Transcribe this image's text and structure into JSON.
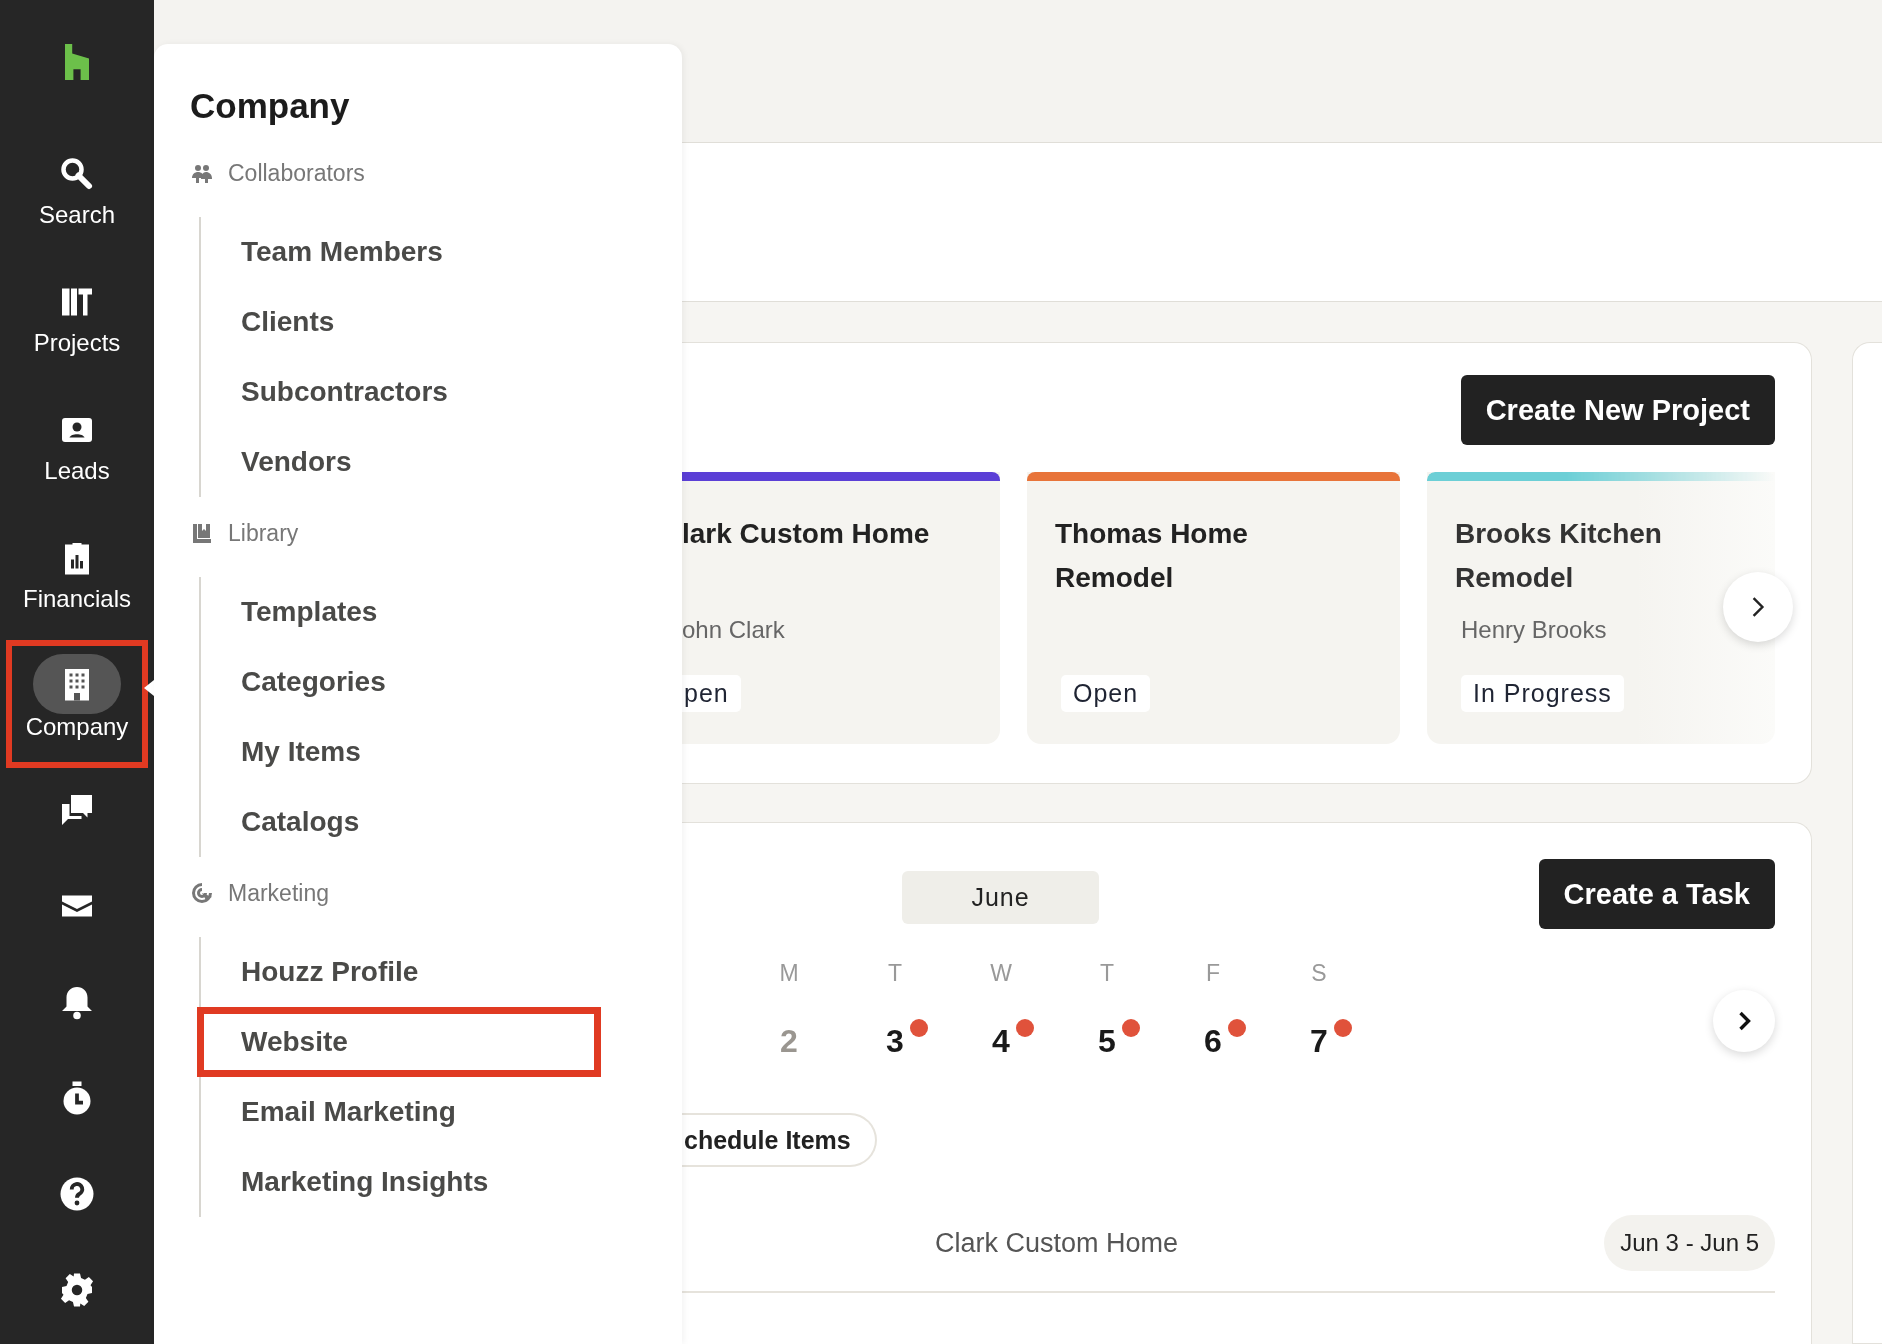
{
  "sidebar": {
    "items": [
      {
        "label": "Search",
        "selected": false,
        "highlighted": false
      },
      {
        "label": "Projects",
        "selected": false,
        "highlighted": false
      },
      {
        "label": "Leads",
        "selected": false,
        "highlighted": false
      },
      {
        "label": "Financials",
        "selected": false,
        "highlighted": false
      },
      {
        "label": "Company",
        "selected": true,
        "highlighted": true
      },
      {
        "selected": false,
        "highlighted": false
      },
      {
        "selected": false,
        "highlighted": false
      },
      {
        "selected": false,
        "highlighted": false
      },
      {
        "selected": false,
        "highlighted": false
      },
      {
        "selected": false,
        "highlighted": false
      },
      {
        "selected": false,
        "highlighted": false
      }
    ]
  },
  "menu": {
    "title": "Company",
    "sections": [
      {
        "heading": "Collaborators",
        "items": [
          {
            "label": "Team Members",
            "highlighted": false
          },
          {
            "label": "Clients",
            "highlighted": false
          },
          {
            "label": "Subcontractors",
            "highlighted": false
          },
          {
            "label": "Vendors",
            "highlighted": false
          }
        ]
      },
      {
        "heading": "Library",
        "items": [
          {
            "label": "Templates",
            "highlighted": false
          },
          {
            "label": "Categories",
            "highlighted": false
          },
          {
            "label": "My Items",
            "highlighted": false
          },
          {
            "label": "Catalogs",
            "highlighted": false
          }
        ]
      },
      {
        "heading": "Marketing",
        "items": [
          {
            "label": "Houzz Profile",
            "highlighted": false
          },
          {
            "label": "Website",
            "highlighted": true
          },
          {
            "label": "Email Marketing",
            "highlighted": false
          },
          {
            "label": "Marketing Insights",
            "highlighted": false
          }
        ]
      }
    ]
  },
  "projects": {
    "button": "Create New Project",
    "cards": [
      {
        "title": "lark Custom Home",
        "client": "ohn Clark",
        "status": "pen",
        "color": "#5b3fd6"
      },
      {
        "title": "Thomas Home Remodel",
        "status": "Open",
        "color": "#e8743a"
      },
      {
        "title": "Brooks Kitchen Remodel",
        "client": "Henry Brooks",
        "status": "In Progress",
        "color": "#6ccfd6"
      }
    ]
  },
  "schedule": {
    "month": "June",
    "button": "Create a Task",
    "days": [
      {
        "weekday": "M",
        "date": "2",
        "dimmed": true,
        "has_events": false
      },
      {
        "weekday": "T",
        "date": "3",
        "dimmed": false,
        "has_events": true
      },
      {
        "weekday": "W",
        "date": "4",
        "dimmed": false,
        "has_events": true
      },
      {
        "weekday": "T",
        "date": "5",
        "dimmed": false,
        "has_events": true
      },
      {
        "weekday": "F",
        "date": "6",
        "dimmed": false,
        "has_events": true
      },
      {
        "weekday": "S",
        "date": "7",
        "dimmed": false,
        "has_events": true
      }
    ],
    "filter": "chedule Items",
    "events": [
      {
        "name": "Clark Custom Home",
        "dates": "Jun 3 - Jun 5"
      }
    ]
  }
}
